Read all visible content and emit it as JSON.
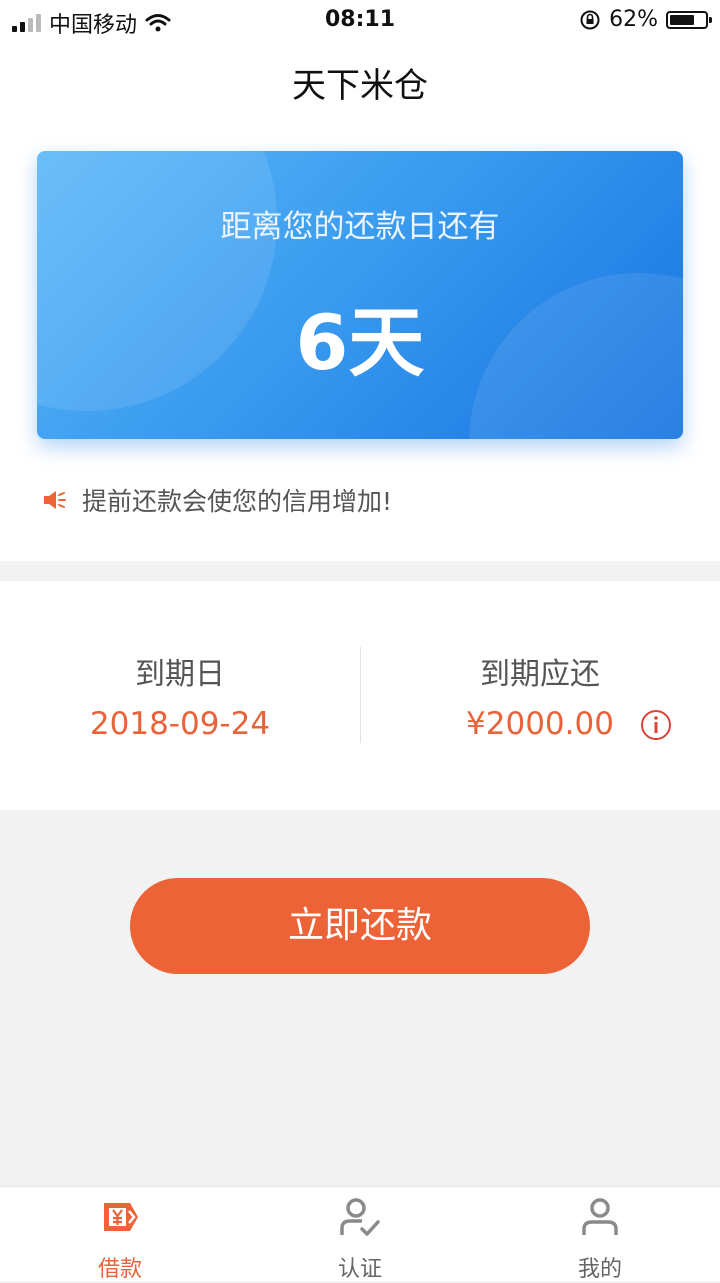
{
  "status_bar": {
    "carrier": "中国移动",
    "time": "08:11",
    "battery_percent": "62%"
  },
  "navbar": {
    "title": "天下米仓"
  },
  "countdown_card": {
    "label": "距离您的还款日还有",
    "days": "6天"
  },
  "tip": {
    "text": "提前还款会使您的信用增加!"
  },
  "due": {
    "date_label": "到期日",
    "date_value": "2018-09-24",
    "amount_label": "到期应还",
    "amount_value": "¥2000.00"
  },
  "pay_button": {
    "label": "立即还款"
  },
  "tabbar": {
    "items": [
      {
        "label": "借款",
        "icon": "loan-icon",
        "active": true
      },
      {
        "label": "认证",
        "icon": "verify-user-icon",
        "active": false
      },
      {
        "label": "我的",
        "icon": "profile-icon",
        "active": false
      }
    ]
  },
  "colors": {
    "accent": "#ec6338",
    "card_gradient_start": "#5bb8f8",
    "card_gradient_end": "#1673e0"
  }
}
